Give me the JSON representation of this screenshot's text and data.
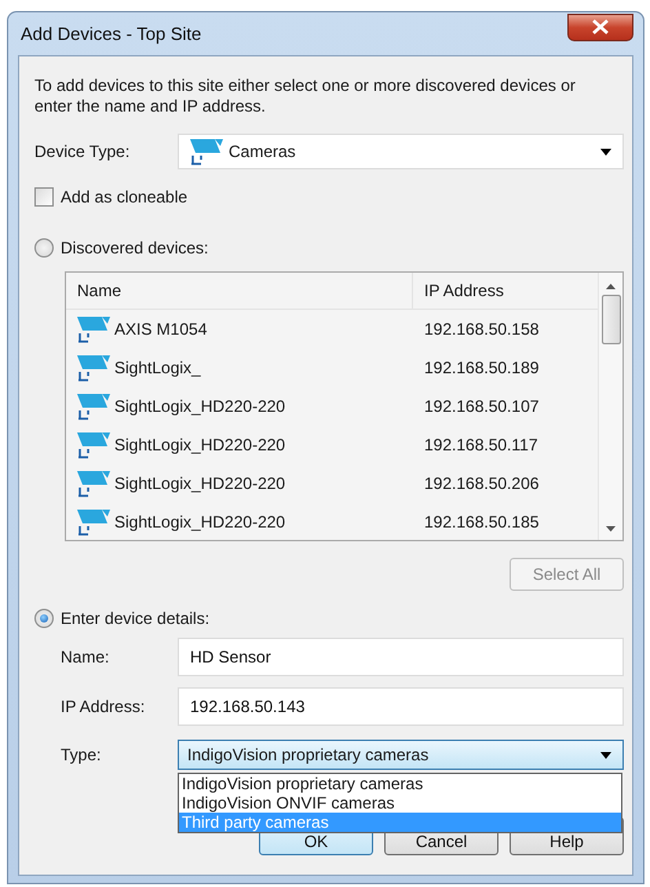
{
  "window": {
    "title": "Add Devices - Top Site"
  },
  "intro": "To add devices to this site either select one or more discovered devices or enter the name and IP address.",
  "device_type": {
    "label": "Device Type:",
    "value": "Cameras"
  },
  "cloneable": {
    "label": "Add as cloneable",
    "checked": false
  },
  "modes": [
    {
      "label": "Discovered devices:",
      "selected": false
    },
    {
      "label": "Enter device details:",
      "selected": true
    }
  ],
  "discovered": {
    "columns": [
      "Name",
      "IP Address"
    ],
    "rows": [
      {
        "name": "AXIS M1054",
        "ip": "192.168.50.158"
      },
      {
        "name": "SightLogix_",
        "ip": "192.168.50.189"
      },
      {
        "name": "SightLogix_HD220-220",
        "ip": "192.168.50.107"
      },
      {
        "name": "SightLogix_HD220-220",
        "ip": "192.168.50.117"
      },
      {
        "name": "SightLogix_HD220-220",
        "ip": "192.168.50.206"
      },
      {
        "name": "SightLogix_HD220-220",
        "ip": "192.168.50.185"
      }
    ]
  },
  "select_all": {
    "label": "Select All",
    "disabled": true
  },
  "details": {
    "name": {
      "label": "Name:",
      "value": "HD Sensor"
    },
    "ip": {
      "label": "IP Address:",
      "value": "192.168.50.143"
    },
    "type": {
      "label": "Type:",
      "value": "IndigoVision proprietary cameras",
      "expanded": true,
      "options": [
        {
          "label": "IndigoVision proprietary cameras",
          "highlighted": false
        },
        {
          "label": "IndigoVision ONVIF cameras",
          "highlighted": false
        },
        {
          "label": "Third party cameras",
          "highlighted": true
        }
      ]
    }
  },
  "buttons": [
    {
      "label": "OK",
      "default": true
    },
    {
      "label": "Cancel",
      "default": false
    },
    {
      "label": "Help",
      "default": false
    }
  ]
}
